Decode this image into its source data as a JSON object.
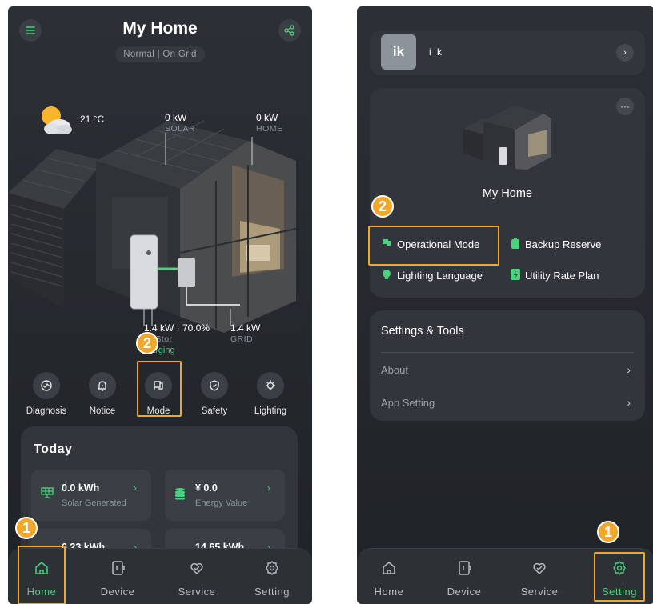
{
  "left": {
    "title": "My Home",
    "status": "Normal | On Grid",
    "menu_icon": "menu-icon",
    "share_icon": "share-icon",
    "weather": {
      "temp": "21 °C",
      "icon": "partly-cloudy-icon"
    },
    "metrics": {
      "solar": {
        "value": "0 kW",
        "label": "SOLAR"
      },
      "home": {
        "value": "0 kW",
        "label": "HOME"
      },
      "battery": {
        "value": "1.4 kW · 70.0%",
        "label": "nStor",
        "status": "arging"
      },
      "grid": {
        "value": "1.4 kW",
        "label": "GRID"
      }
    },
    "quick_actions": [
      {
        "label": "Diagnosis",
        "icon": "diagnosis-icon",
        "glyph": "⊗"
      },
      {
        "label": "Notice",
        "icon": "bell-icon",
        "glyph": "🔔"
      },
      {
        "label": "Mode",
        "icon": "mode-flag-icon",
        "glyph": "⚐"
      },
      {
        "label": "Safety",
        "icon": "shield-icon",
        "glyph": "⛉"
      },
      {
        "label": "Lighting",
        "icon": "bulb-icon",
        "glyph": "✺"
      }
    ],
    "today": {
      "title": "Today",
      "tiles": [
        {
          "value": "0.0 kWh",
          "label": "Solar Generated",
          "icon": "solar-panel-icon"
        },
        {
          "value": "¥ 0.0",
          "label": "Energy Value",
          "icon": "coins-icon"
        },
        {
          "value": "6.23 kWh",
          "label": "",
          "icon": "grid-icon"
        },
        {
          "value": "14.65 kWh",
          "label": "",
          "icon": "home-usage-icon"
        }
      ]
    },
    "badges": {
      "step1": "1",
      "step2": "2"
    }
  },
  "right": {
    "user": {
      "initials": "ik",
      "name": "i k"
    },
    "home_name": "My Home",
    "more_icon": "more-icon",
    "options": [
      {
        "label": "Operational Mode",
        "icon": "operational-mode-icon"
      },
      {
        "label": "Backup Reserve",
        "icon": "battery-icon"
      },
      {
        "label": "Lighting Language",
        "icon": "lighting-icon"
      },
      {
        "label": "Utility Rate Plan",
        "icon": "rate-plan-icon"
      }
    ],
    "settings": {
      "title": "Settings & Tools",
      "items": [
        {
          "label": "About"
        },
        {
          "label": "App Setting"
        }
      ]
    },
    "badges": {
      "step1": "1",
      "step2": "2"
    }
  },
  "tabs": [
    {
      "label": "Home",
      "icon": "home-icon"
    },
    {
      "label": "Device",
      "icon": "device-icon"
    },
    {
      "label": "Service",
      "icon": "service-icon"
    },
    {
      "label": "Setting",
      "icon": "gear-icon"
    }
  ],
  "colors": {
    "accent": "#49d17b",
    "highlight": "#f0a72b",
    "background": "#26292e",
    "card": "#32363c"
  }
}
